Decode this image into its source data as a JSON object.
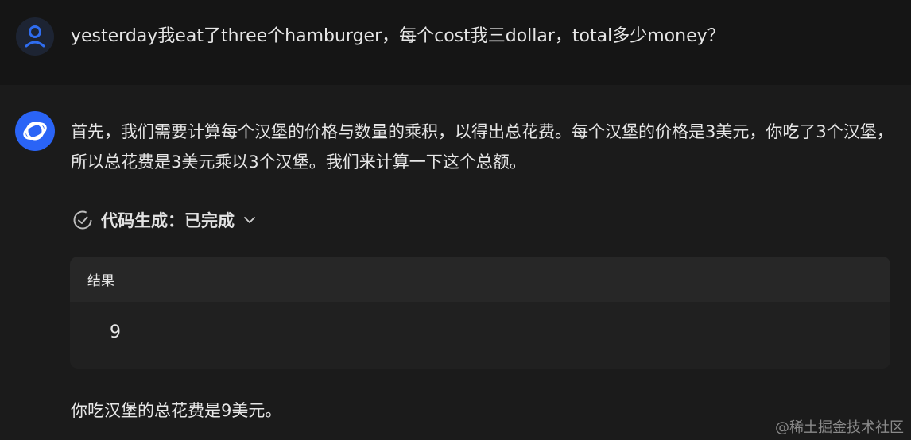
{
  "user_message": {
    "text": "yesterday我eat了three个hamburger，每个cost我三dollar，total多少money？"
  },
  "assistant_message": {
    "intro": "首先，我们需要计算每个汉堡的价格与数量的乘积，以得出总花费。每个汉堡的价格是3美元，你吃了3个汉堡，所以总花费是3美元乘以3个汉堡。我们来计算一下这个总额。",
    "code_status_label": "代码生成：已完成",
    "result_header": "结果",
    "result_value": "9",
    "final_answer": "你吃汉堡的总花费是9美元。"
  },
  "watermark": "@稀土掘金技术社区",
  "colors": {
    "background": "#1b1b1b",
    "user_row": "#151515",
    "bot_avatar": "#2a64f6",
    "user_avatar_icon": "#2f6df0"
  },
  "icons": {
    "user_avatar": "user-avatar-icon",
    "bot_avatar": "assistant-logo-icon",
    "status": "check-circle-icon",
    "toggle": "chevron-down-icon"
  }
}
